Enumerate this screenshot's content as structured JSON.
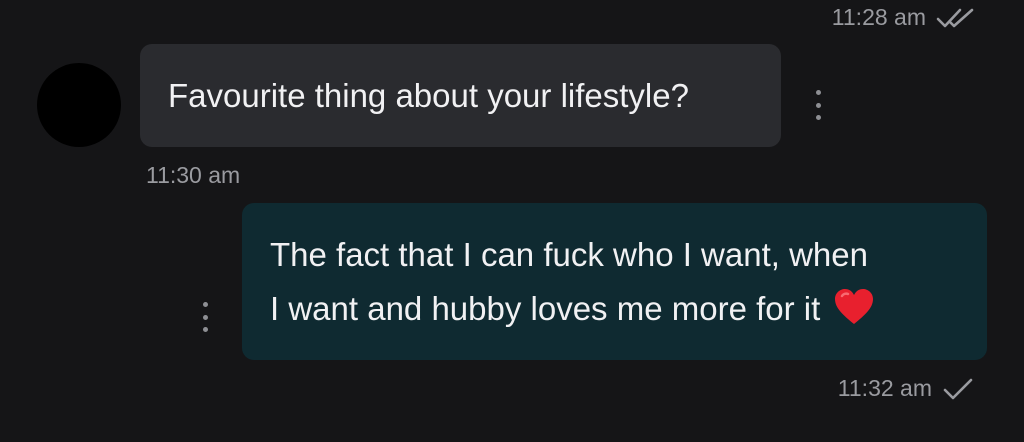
{
  "conversation": {
    "top_status": {
      "time": "11:28 am",
      "receipt_icon": "double-check-icon"
    },
    "incoming_message": {
      "text": "Favourite thing about your lifestyle?",
      "time": "11:30 am",
      "menu_icon": "kebab-icon"
    },
    "outgoing_message": {
      "line1": "The fact that I can fuck who I want, when",
      "line2": "I want and hubby loves me more for it",
      "emoji": "red-heart",
      "time": "11:32 am",
      "receipt_icon": "single-check-icon",
      "menu_icon": "kebab-icon"
    }
  },
  "colors": {
    "background": "#151517",
    "incoming_bubble": "#2a2b2f",
    "outgoing_bubble": "#0f2a31",
    "message_text": "#f1f1f3",
    "meta_text": "#9a9ba0",
    "heart": "#e8202e"
  }
}
